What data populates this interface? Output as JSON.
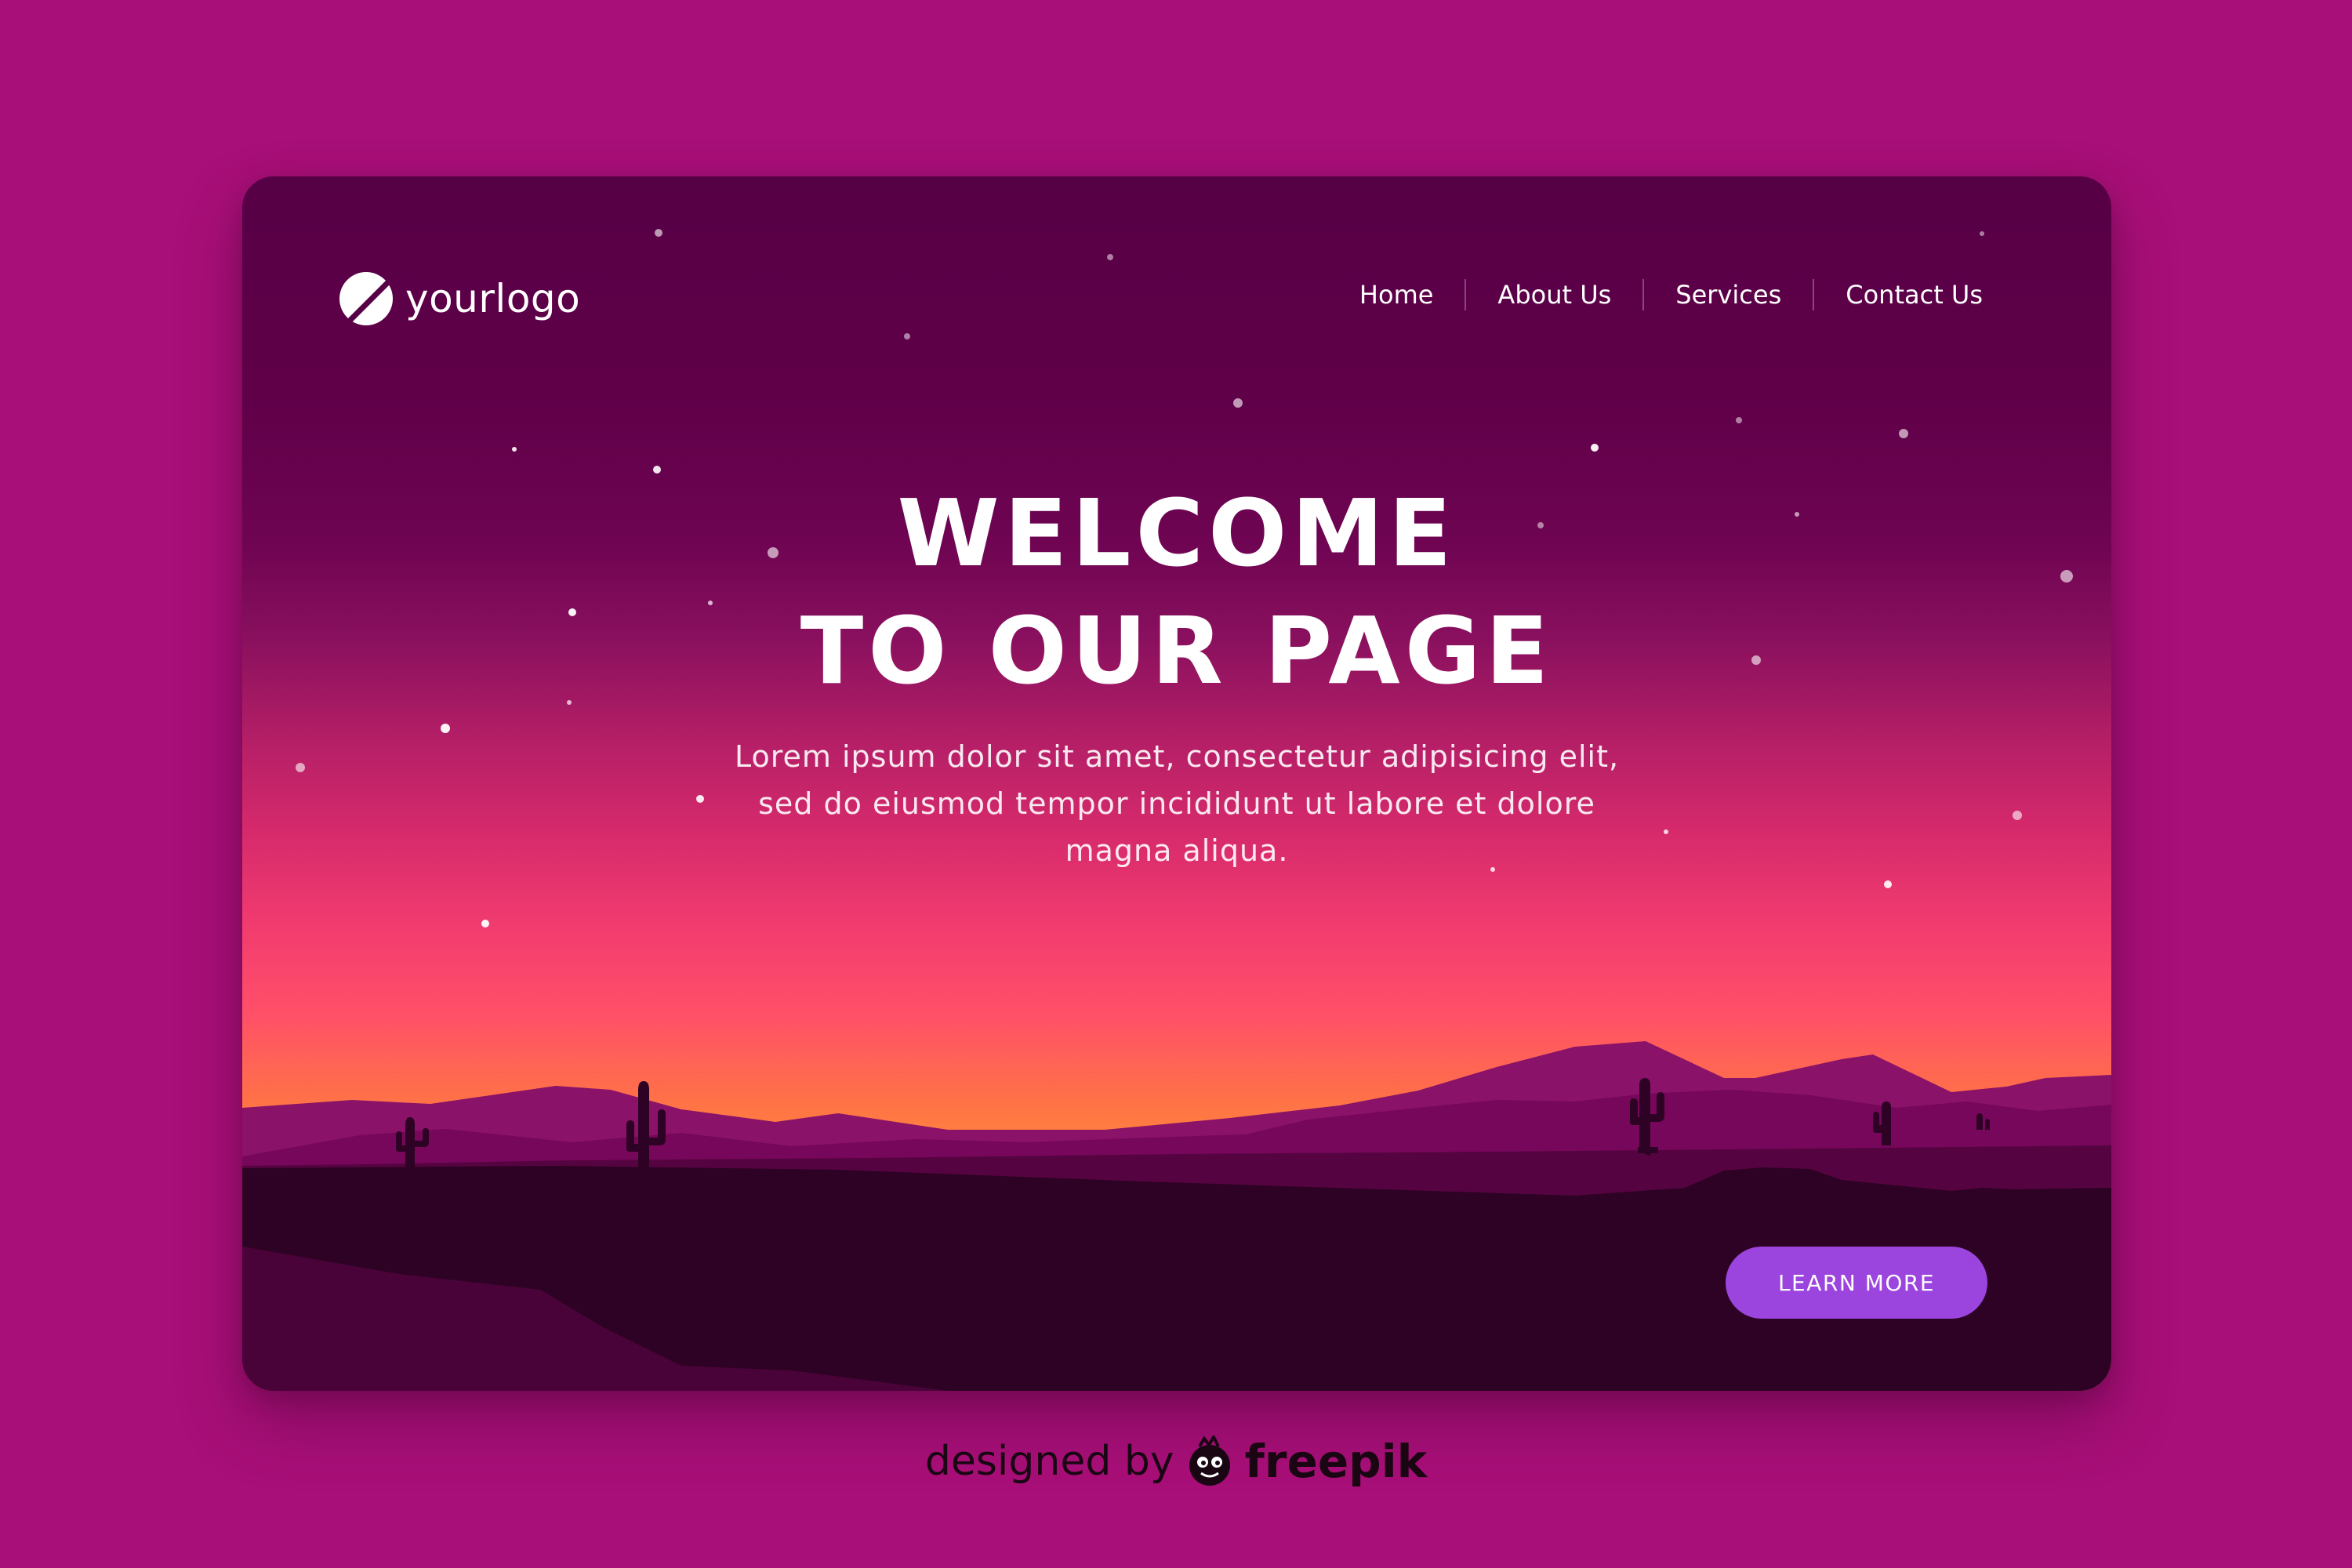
{
  "logo": {
    "text": "yourlogo",
    "icon": "logo-mark-icon"
  },
  "nav": {
    "items": [
      {
        "label": "Home"
      },
      {
        "label": "About Us"
      },
      {
        "label": "Services"
      },
      {
        "label": "Contact Us"
      }
    ]
  },
  "hero": {
    "title_line1": "WELCOME",
    "title_line2": "TO OUR PAGE",
    "description": "Lorem ipsum dolor sit amet, consectetur adipisicing elit, sed do eiusmod tempor incididunt ut labore et dolore magna aliqua."
  },
  "cta": {
    "label": "LEARN MORE"
  },
  "credit": {
    "prefix": "designed by",
    "brand": "freepik",
    "icon": "freepik-mascot-icon"
  },
  "colors": {
    "page_background": "#a80f78",
    "button": "#9b44de",
    "sky_top": "#560046",
    "horizon": "#ff8a3a",
    "ground": "#2e0224"
  }
}
